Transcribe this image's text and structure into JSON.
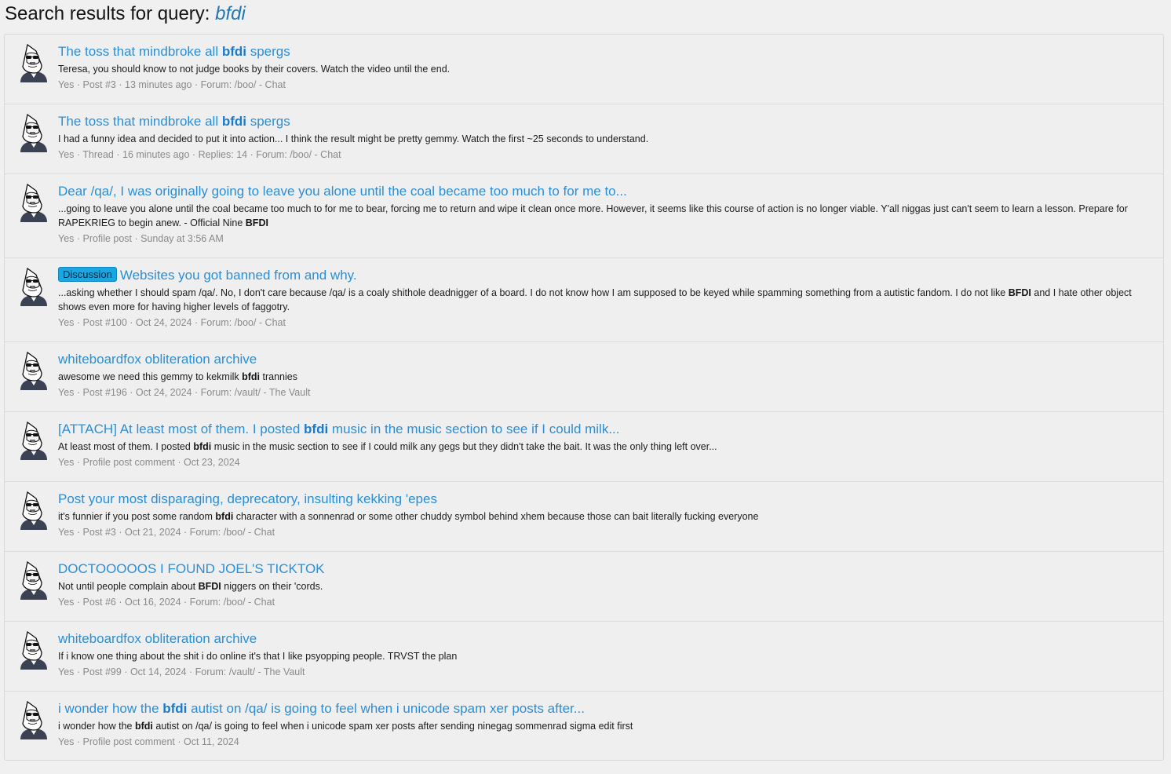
{
  "header": {
    "title_prefix": "Search results for query:",
    "query": "bfdi"
  },
  "avatar_icon": "hooded-figure-sunglasses-avatar",
  "results": [
    {
      "title": [
        {
          "t": "The toss that mindbroke all "
        },
        {
          "t": "bfdi",
          "b": true
        },
        {
          "t": " spergs"
        }
      ],
      "snippet": [
        {
          "t": "Teresa, you should know to not judge books by their covers. Watch the video until the end."
        }
      ],
      "meta": "Yes · Post #3 · 13 minutes ago · Forum: /boo/ - Chat"
    },
    {
      "title": [
        {
          "t": "The toss that mindbroke all "
        },
        {
          "t": "bfdi",
          "b": true
        },
        {
          "t": " spergs"
        }
      ],
      "snippet": [
        {
          "t": "I had a funny idea and decided to put it into action... I think the result might be pretty gemmy. Watch the first ~25 seconds to understand."
        }
      ],
      "meta": "Yes · Thread · 16 minutes ago · Replies: 14 · Forum: /boo/ - Chat"
    },
    {
      "title": [
        {
          "t": "Dear /qa/, I was originally going to leave you alone until the coal became too much to for me to..."
        }
      ],
      "snippet": [
        {
          "t": "...going to leave you alone until the coal became too much to for me to bear, forcing me to return and wipe it clean once more. However, it seems like this course of action is no longer viable. Y'all niggas just can't seem to learn a lesson. Prepare for RAPEKRIEG to begin anew. - Official Nine "
        },
        {
          "t": "BFDI",
          "b": true
        }
      ],
      "meta": "Yes · Profile post · Sunday at 3:56 AM"
    },
    {
      "badge": "Discussion",
      "title": [
        {
          "t": "Websites you got banned from and why."
        }
      ],
      "snippet": [
        {
          "t": "...asking whether I should spam /qa/. No, I don't care because /qa/ is a coaly shithole deadnigger of a board. I do not know how I am supposed to be keyed while spamming something from a autistic fandom. I do not like "
        },
        {
          "t": "BFDI",
          "b": true
        },
        {
          "t": " and I hate other object shows even more for having higher levels of faggotry."
        }
      ],
      "meta": "Yes · Post #100 · Oct 24, 2024 · Forum: /boo/ - Chat"
    },
    {
      "title": [
        {
          "t": "whiteboardfox obliteration archive"
        }
      ],
      "snippet": [
        {
          "t": "awesome we need this gemmy to kekmilk "
        },
        {
          "t": "bfdi",
          "b": true
        },
        {
          "t": " trannies"
        }
      ],
      "meta": "Yes · Post #196 · Oct 24, 2024 · Forum: /vault/ - The Vault"
    },
    {
      "title": [
        {
          "t": "[ATTACH] At least most of them. I posted "
        },
        {
          "t": "bfdi",
          "b": true
        },
        {
          "t": " music in the music section to see if I could milk..."
        }
      ],
      "snippet": [
        {
          "t": "At least most of them. I posted "
        },
        {
          "t": "bfdi",
          "b": true
        },
        {
          "t": " music in the music section to see if I could milk any gegs but they didn't take the bait. It was the only thing left over..."
        }
      ],
      "meta": "Yes · Profile post comment · Oct 23, 2024"
    },
    {
      "title": [
        {
          "t": "Post your most disparaging, deprecatory, insulting kekking 'epes"
        }
      ],
      "snippet": [
        {
          "t": "it's funnier if you post some random "
        },
        {
          "t": "bfdi",
          "b": true
        },
        {
          "t": " character with a sonnenrad or some other chuddy symbol behind xhem because those can bait literally fucking everyone"
        }
      ],
      "meta": "Yes · Post #3 · Oct 21, 2024 · Forum: /boo/ - Chat"
    },
    {
      "title": [
        {
          "t": "DOCTOOOOOS I FOUND JOEL'S TICKTOK"
        }
      ],
      "snippet": [
        {
          "t": "Not until people complain about "
        },
        {
          "t": "BFDI",
          "b": true
        },
        {
          "t": " niggers on their 'cords."
        }
      ],
      "meta": "Yes · Post #6 · Oct 16, 2024 · Forum: /boo/ - Chat"
    },
    {
      "title": [
        {
          "t": "whiteboardfox obliteration archive"
        }
      ],
      "snippet": [
        {
          "t": "If i know one thing about the shit i do online it's that I like psyopping people. TRVST the plan"
        }
      ],
      "meta": "Yes · Post #99 · Oct 14, 2024 · Forum: /vault/ - The Vault"
    },
    {
      "title": [
        {
          "t": "i wonder how the "
        },
        {
          "t": "bfdi",
          "b": true
        },
        {
          "t": " autist on /qa/ is going to feel when i unicode spam xer posts after..."
        }
      ],
      "snippet": [
        {
          "t": "i wonder how the "
        },
        {
          "t": "bfdi",
          "b": true
        },
        {
          "t": " autist on /qa/ is going to feel when i unicode spam xer posts after sending ninegag sommenrad sigma edit first"
        }
      ],
      "meta": "Yes · Profile post comment · Oct 11, 2024"
    }
  ]
}
